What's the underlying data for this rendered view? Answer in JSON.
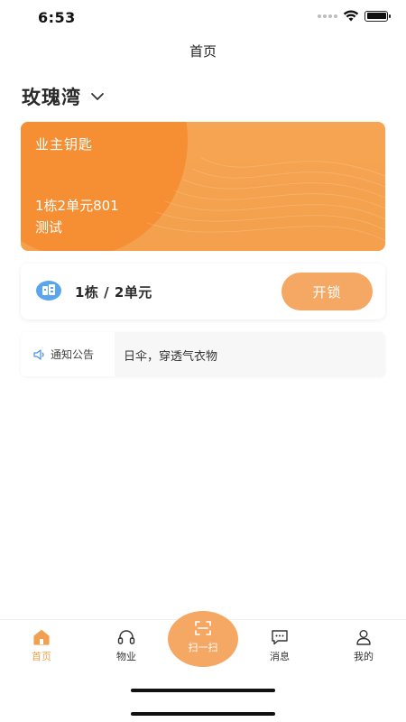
{
  "status_bar": {
    "time": "6:53"
  },
  "nav": {
    "title": "首页"
  },
  "community": {
    "name": "玫瑰湾"
  },
  "key_card": {
    "title": "业主钥匙",
    "address": "1栋2单元801",
    "owner_name": "测试"
  },
  "unlock": {
    "building_unit": "1栋 / 2单元",
    "button_label": "开锁"
  },
  "notice": {
    "label": "通知公告",
    "text": "日伞，穿透气衣物"
  },
  "tab_bar": {
    "home": "首页",
    "property": "物业",
    "scan": "扫一扫",
    "messages": "消息",
    "mine": "我的"
  },
  "colors": {
    "accent": "#f5a864",
    "card_orange": "#f4a04d",
    "active_tab": "#f0a050"
  }
}
